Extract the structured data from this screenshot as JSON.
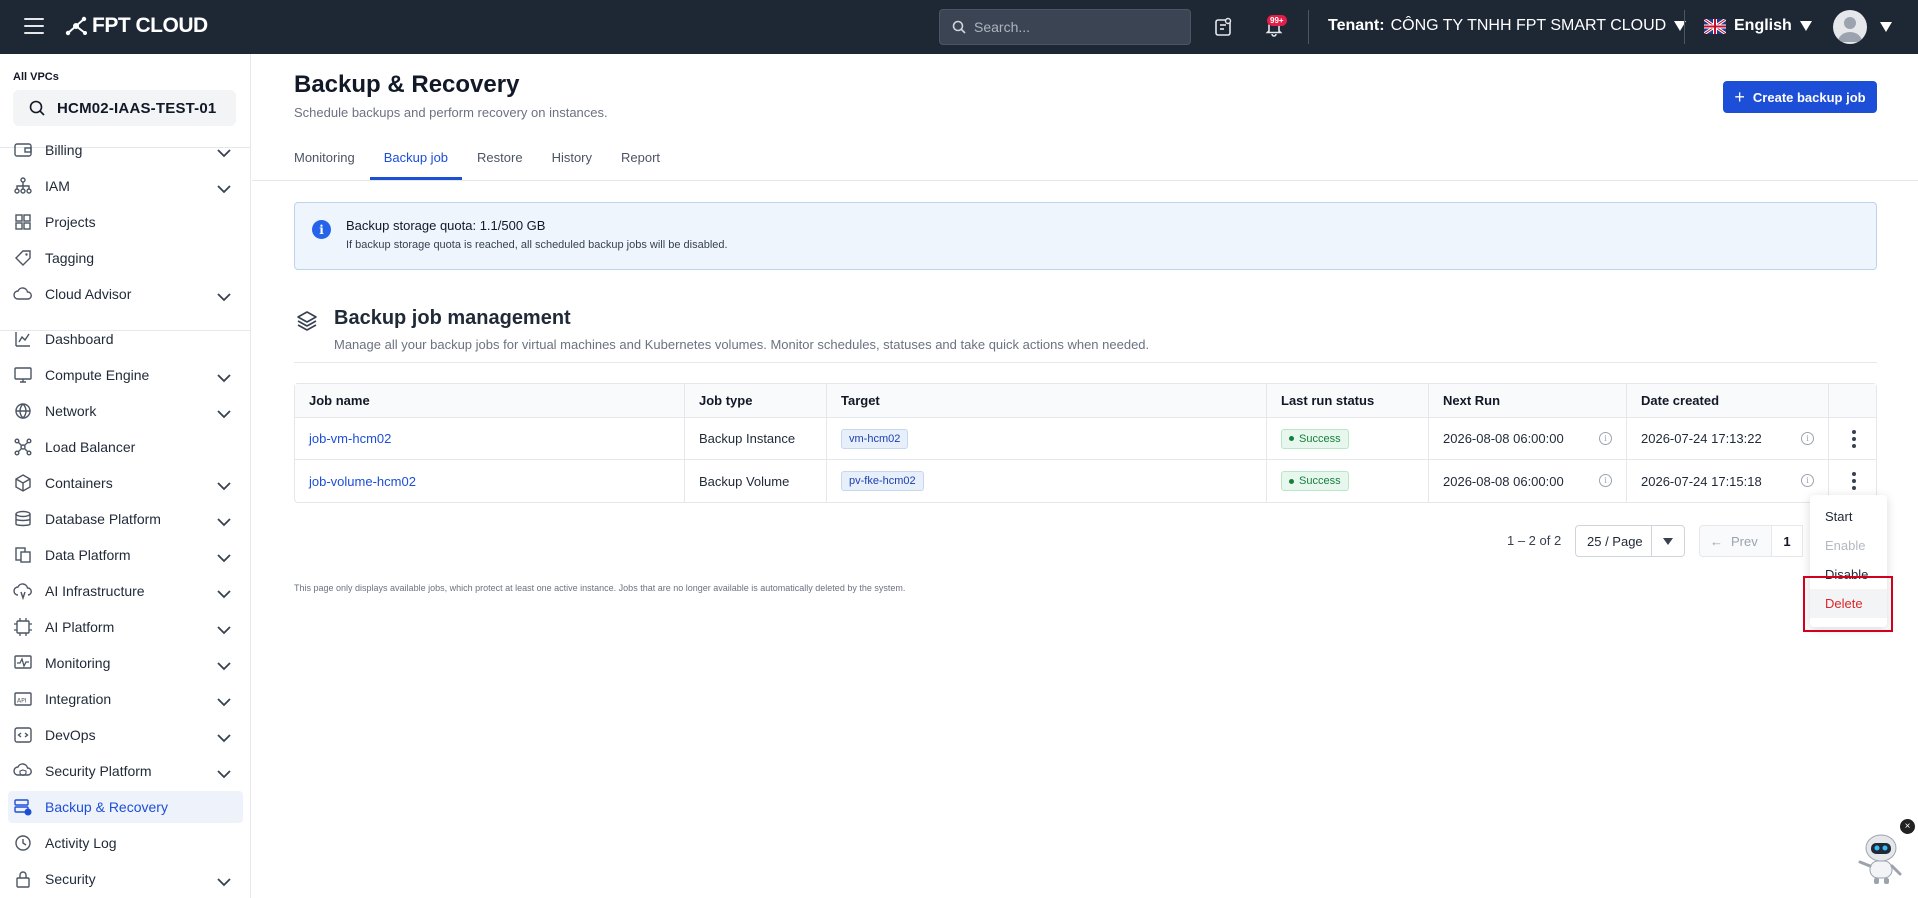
{
  "header": {
    "brand": "FPT CLOUD",
    "search_placeholder": "Search...",
    "notification_count": "99+",
    "tenant_label": "Tenant:",
    "tenant_name": "CÔNG TY TNHH FPT SMART CLOUD",
    "language": "English"
  },
  "sidebar": {
    "vpc_label": "All VPCs",
    "vpc_name": "HCM02-IAAS-TEST-01",
    "items": [
      {
        "label": "Billing",
        "icon": "wallet-icon",
        "expandable": true
      },
      {
        "label": "IAM",
        "icon": "org-chart-icon",
        "expandable": true
      },
      {
        "label": "Projects",
        "icon": "grid-icon",
        "expandable": false
      },
      {
        "label": "Tagging",
        "icon": "tag-icon",
        "expandable": false
      },
      {
        "label": "Cloud Advisor",
        "icon": "cloud-icon",
        "expandable": true
      },
      {
        "label": "Dashboard",
        "icon": "chart-icon",
        "expandable": false
      },
      {
        "label": "Compute Engine",
        "icon": "monitor-icon",
        "expandable": true
      },
      {
        "label": "Network",
        "icon": "globe-icon",
        "expandable": true
      },
      {
        "label": "Load Balancer",
        "icon": "network-nodes-icon",
        "expandable": false
      },
      {
        "label": "Containers",
        "icon": "box-icon",
        "expandable": true
      },
      {
        "label": "Database Platform",
        "icon": "database-icon",
        "expandable": true
      },
      {
        "label": "Data Platform",
        "icon": "data-icon",
        "expandable": true
      },
      {
        "label": "AI Infrastructure",
        "icon": "ai-cloud-icon",
        "expandable": true
      },
      {
        "label": "AI Platform",
        "icon": "ai-chip-icon",
        "expandable": true
      },
      {
        "label": "Monitoring",
        "icon": "monitoring-icon",
        "expandable": true
      },
      {
        "label": "Integration",
        "icon": "api-icon",
        "expandable": true
      },
      {
        "label": "DevOps",
        "icon": "code-icon",
        "expandable": true
      },
      {
        "label": "Security Platform",
        "icon": "shield-cloud-icon",
        "expandable": true
      },
      {
        "label": "Backup & Recovery",
        "icon": "backup-icon",
        "expandable": false,
        "active": true
      },
      {
        "label": "Activity Log",
        "icon": "clock-icon",
        "expandable": false
      },
      {
        "label": "Security",
        "icon": "lock-icon",
        "expandable": true
      }
    ]
  },
  "page": {
    "title": "Backup & Recovery",
    "subtitle": "Schedule backups and perform recovery on instances.",
    "create_button": "Create backup job",
    "tabs": [
      {
        "label": "Monitoring",
        "active": false
      },
      {
        "label": "Backup job",
        "active": true
      },
      {
        "label": "Restore",
        "active": false
      },
      {
        "label": "History",
        "active": false
      },
      {
        "label": "Report",
        "active": false
      }
    ]
  },
  "info": {
    "title": "Backup storage quota: 1.1/500 GB",
    "text": "If backup storage quota is reached, all scheduled backup jobs will be disabled."
  },
  "section": {
    "title": "Backup job management",
    "description": "Manage all your backup jobs for virtual machines and Kubernetes volumes. Monitor schedules, statuses and take quick actions when needed."
  },
  "table": {
    "columns": [
      "Job name",
      "Job type",
      "Target",
      "Last run status",
      "Next Run",
      "Date created"
    ],
    "rows": [
      {
        "name": "job-vm-hcm02",
        "type": "Backup Instance",
        "target": "vm-hcm02",
        "status": "Success",
        "next_run": "2026-08-08 06:00:00",
        "created": "2026-07-24 17:13:22"
      },
      {
        "name": "job-volume-hcm02",
        "type": "Backup Volume",
        "target": "pv-fke-hcm02",
        "status": "Success",
        "next_run": "2026-08-08 06:00:00",
        "created": "2026-07-24 17:15:18"
      }
    ]
  },
  "pagination": {
    "range": "1 – 2 of 2",
    "page_size": "25 / Page",
    "prev": "Prev",
    "current_page": "1"
  },
  "footnote": "This page only displays available jobs, which protect at least one active instance. Jobs that are no longer available is automatically deleted by the system.",
  "context_menu": {
    "items": [
      {
        "label": "Start",
        "disabled": false
      },
      {
        "label": "Enable",
        "disabled": true
      },
      {
        "label": "Disable",
        "disabled": false
      },
      {
        "label": "Delete",
        "disabled": false,
        "danger": true
      }
    ]
  },
  "colors": {
    "topbar": "#1e2734",
    "accent": "#1d4ed8",
    "success": "#15803d",
    "danger": "#dc2626",
    "highlight": "#d0021b"
  }
}
